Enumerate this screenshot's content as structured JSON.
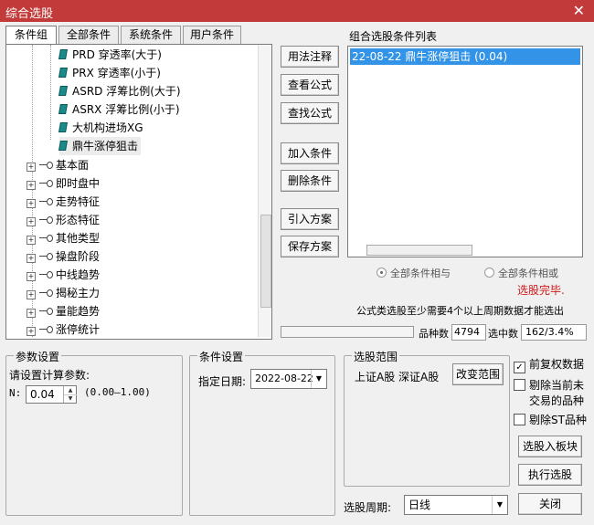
{
  "title": "综合选股",
  "close_glyph": "✕",
  "tabs": [
    "条件组",
    "全部条件",
    "系统条件",
    "用户条件"
  ],
  "tree": {
    "leaves": [
      "PRD 穿透率(大于)",
      "PRX 穿透率(小于)",
      "ASRD 浮筹比例(大于)",
      "ASRX 浮筹比例(小于)",
      "大机构进场XG",
      "鼎牛涨停狙击"
    ],
    "groups": [
      "基本面",
      "即时盘中",
      "走势特征",
      "形态特征",
      "其他类型",
      "操盘阶段",
      "中线趋势",
      "揭秘主力",
      "量能趋势",
      "涨停统计"
    ],
    "expander": "+"
  },
  "buttons": {
    "usage": "用法注释",
    "view_formula": "查看公式",
    "find_formula": "查找公式",
    "add_condition": "加入条件",
    "delete_condition": "删除条件",
    "import_scheme": "引入方案",
    "save_scheme": "保存方案",
    "change_range": "改变范围",
    "to_block": "选股入板块",
    "execute": "执行选股",
    "close": "关闭"
  },
  "condition_list": {
    "label": "组合选股条件列表",
    "items": [
      "22-08-22 鼎牛涨停狙击 (0.04)"
    ]
  },
  "radios": {
    "and_label": "全部条件相与",
    "or_label": "全部条件相或"
  },
  "status_done": "选股完毕.",
  "notice": "公式类选股至少需要4个以上周期数据才能选出",
  "stats": {
    "variety_label": "品种数",
    "variety_value": "4794",
    "selected_label": "选中数",
    "selected_value": "162/3.4%"
  },
  "params": {
    "group_title": "参数设置",
    "prompt": "请设置计算参数:",
    "n_label": "N:",
    "n_value": "0.04",
    "range": "(0.00—1.00)"
  },
  "cond_settings": {
    "group_title": "条件设置",
    "date_label": "指定日期:",
    "date_value": "2022-08-22"
  },
  "range": {
    "group_title": "选股范围",
    "text": "上证A股 深证A股"
  },
  "checkboxes": {
    "forward_adjust": "前复权数据",
    "exclude_untraded_line1": "剔除当前未",
    "exclude_untraded_line2": "交易的品种",
    "exclude_st": "剔除ST品种",
    "check_glyph": "✓"
  },
  "period": {
    "label": "选股周期:",
    "value": "日线"
  },
  "icons": {
    "spin_up": "▲",
    "spin_down": "▼",
    "dropdown": "▼"
  }
}
